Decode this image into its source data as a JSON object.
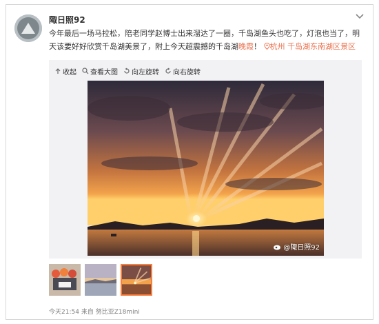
{
  "user": {
    "name": "陬日照92"
  },
  "post": {
    "text_before": "今年最后一场马拉松，陪老同学赵博士出来溜达了一圈，千岛湖鱼头也吃了，灯泡也当了，明天该要好好欣赏千岛湖美景了，附上今天超震撼的千岛湖",
    "highlight": "晚霞",
    "text_after": "！",
    "location": "杭州 千岛湖东南湖区景区"
  },
  "toolbar": {
    "collapse": "收起",
    "view_large": "查看大图",
    "rotate_left": "向左旋转",
    "rotate_right": "向右旋转"
  },
  "watermark": "@陬日照92",
  "thumbnails": [
    "crowd",
    "lake",
    "sunset"
  ],
  "footer": {
    "time": "今天21:54",
    "source_prefix": "来自",
    "device": "努比亚Z18mini"
  },
  "colors": {
    "accent": "#eb7350",
    "link": "#eb7350",
    "selected_border": "#fa7d3c"
  }
}
